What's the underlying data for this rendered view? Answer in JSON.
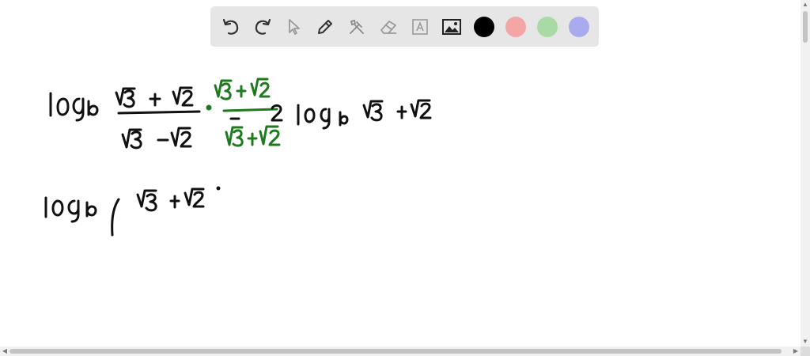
{
  "toolbar": {
    "tools": [
      {
        "name": "undo-icon"
      },
      {
        "name": "redo-icon"
      },
      {
        "name": "select-pointer-icon"
      },
      {
        "name": "pen-icon"
      },
      {
        "name": "tools-icon"
      },
      {
        "name": "eraser-icon"
      },
      {
        "name": "text-icon"
      },
      {
        "name": "image-icon"
      }
    ],
    "colors": [
      "#000000",
      "#f4a6a6",
      "#a9d9a5",
      "#a9abee"
    ]
  },
  "ink": {
    "black": "#111111",
    "green": "#1f7a1f"
  }
}
